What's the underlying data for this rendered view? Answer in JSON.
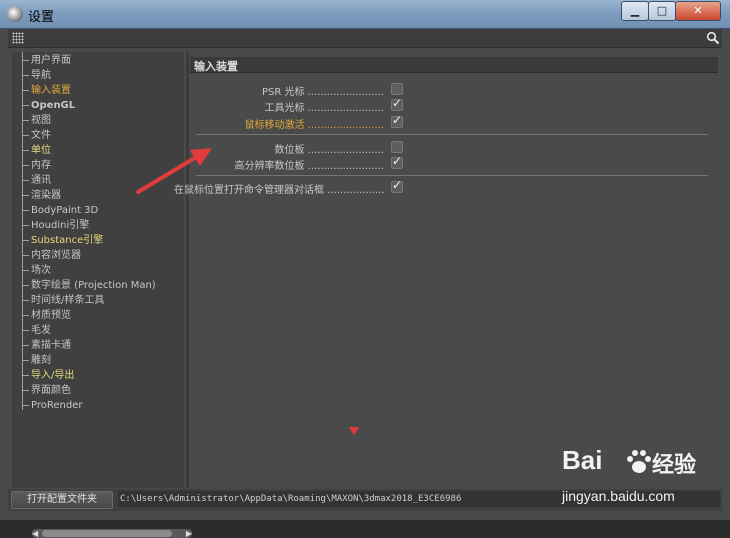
{
  "window": {
    "title": "设置",
    "min_glyph": "▁",
    "max_glyph": "□",
    "close_glyph": "✕"
  },
  "sidebar": {
    "items": [
      {
        "label": "用户界面"
      },
      {
        "label": "导航"
      },
      {
        "label": "输入装置",
        "active": true
      },
      {
        "label": "OpenGL",
        "bold": true
      },
      {
        "label": "视图"
      },
      {
        "label": "文件"
      },
      {
        "label": "单位",
        "yellow": true
      },
      {
        "label": "内存"
      },
      {
        "label": "通讯"
      },
      {
        "label": "渲染器",
        "expandable": true
      },
      {
        "label": "BodyPaint 3D"
      },
      {
        "label": "Houdini引擎"
      },
      {
        "label": "Substance引擎",
        "yellow": true
      },
      {
        "label": "内容浏览器"
      },
      {
        "label": "场次"
      },
      {
        "label": "数字绘景 (Projection Man)"
      },
      {
        "label": "时间线/样条工具"
      },
      {
        "label": "材质预览"
      },
      {
        "label": "毛发"
      },
      {
        "label": "素描卡通"
      },
      {
        "label": "雕刻"
      },
      {
        "label": "导入/导出",
        "expandable": true,
        "yellow": true
      },
      {
        "label": "界面颜色",
        "expandable": true
      },
      {
        "label": "ProRender"
      }
    ]
  },
  "content": {
    "section_title": "输入装置",
    "options": [
      {
        "label": "PSR 光标",
        "checked": false,
        "highlight": false
      },
      {
        "label": "工具光标",
        "checked": true,
        "highlight": false
      },
      {
        "label": "鼠标移动激活",
        "checked": true,
        "highlight": true
      },
      {
        "label": "数位板",
        "checked": false,
        "highlight": false
      },
      {
        "label": "高分辨率数位板",
        "checked": true,
        "highlight": false
      },
      {
        "label": "在鼠标位置打开命令管理器对话框",
        "checked": true,
        "highlight": false
      }
    ]
  },
  "footer": {
    "button_label": "打开配置文件夹",
    "path": "C:\\Users\\Administrator\\AppData\\Roaming\\MAXON\\3dmax2018_E3CE6986"
  },
  "watermark": {
    "logo": "Bai",
    "tail": "经验",
    "url": "jingyan.baidu.com"
  },
  "colors": {
    "accent": "#e0a838",
    "arrow": "#e23b3b",
    "panel": "#4a4a4a"
  }
}
